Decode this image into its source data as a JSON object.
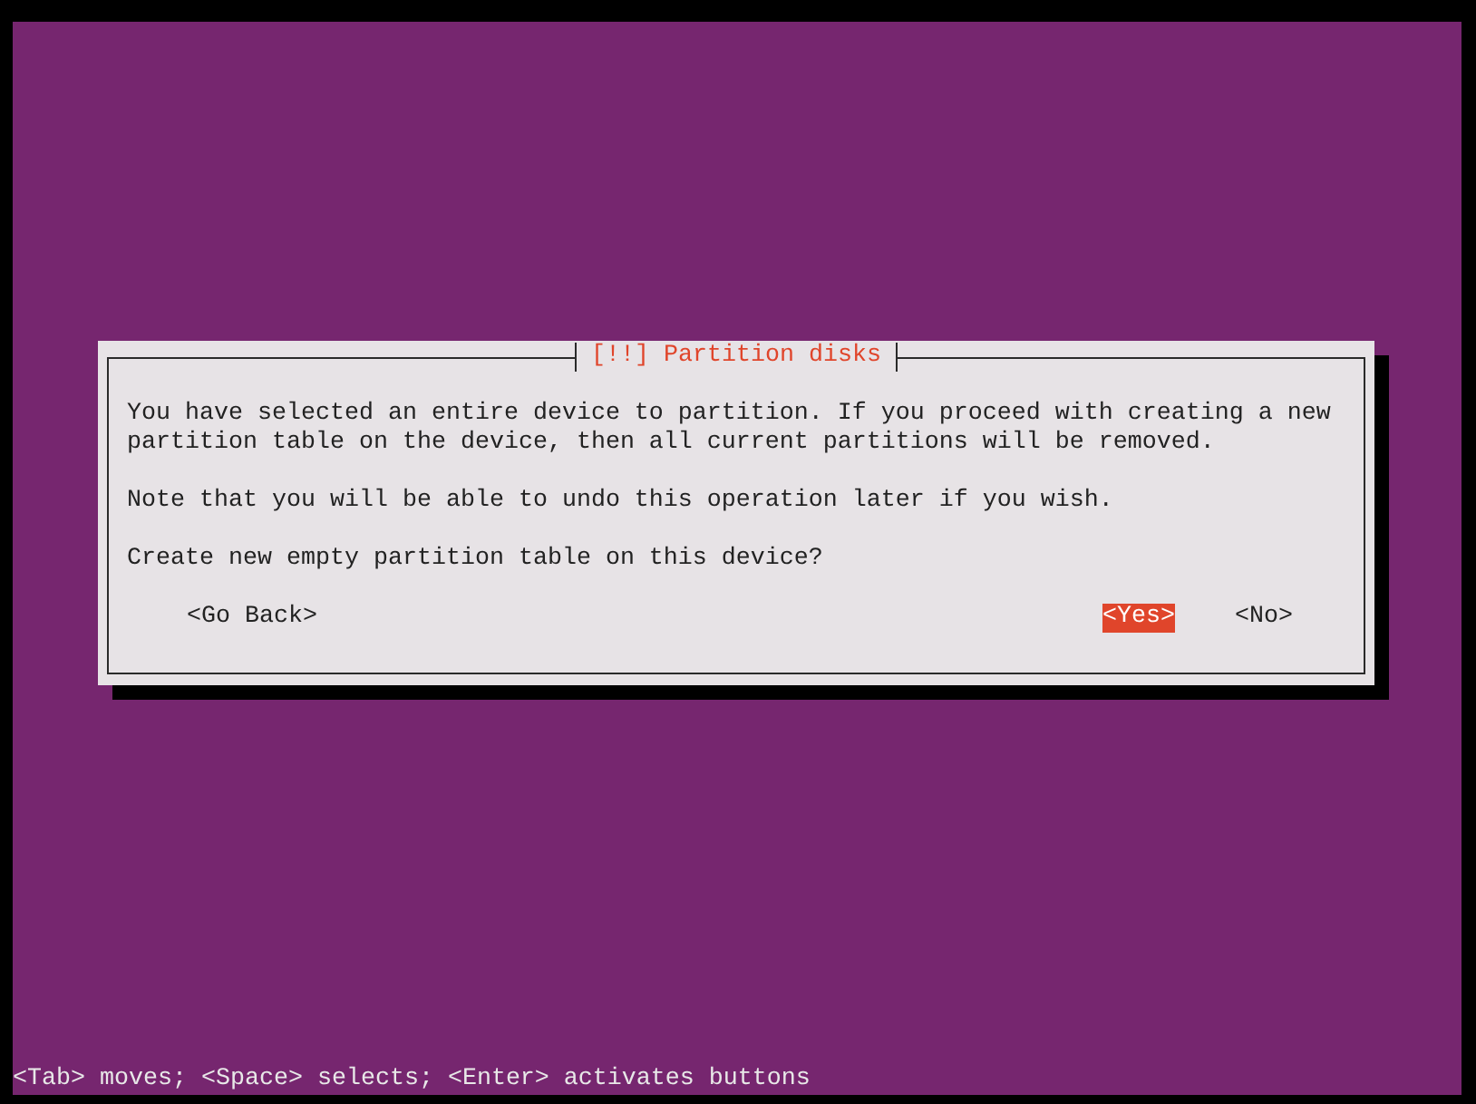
{
  "dialog": {
    "title": "[!!] Partition disks",
    "paragraphs": [
      "You have selected an entire device to partition. If you proceed with creating a new partition table on the device, then all current partitions will be removed.",
      "Note that you will be able to undo this operation later if you wish.",
      "Create new empty partition table on this device?"
    ],
    "buttons": [
      {
        "label": "<Go Back>",
        "selected": false
      },
      {
        "label": "<Yes>",
        "selected": true
      },
      {
        "label": "<No>",
        "selected": false
      }
    ]
  },
  "status_bar": "<Tab> moves; <Space> selects; <Enter> activates buttons"
}
